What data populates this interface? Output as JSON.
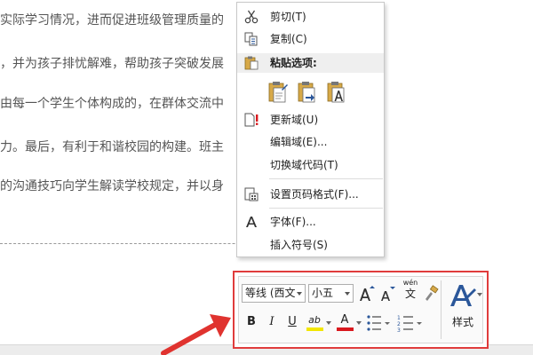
{
  "document": {
    "lines": [
      "实际学习情况，进而促进班级管理质量的",
      "，并为孩子排忧解难，帮助孩子突破发展",
      "由每一个学生个体构成的，在群体交流中",
      "力。最后，有利于和谐校园的构建。班主",
      "的沟通技巧向学生解读学校规定，并以身"
    ]
  },
  "context_menu": {
    "cut": "剪切(T)",
    "copy": "复制(C)",
    "paste_options": "粘贴选项:",
    "update_field": "更新域(U)",
    "edit_field": "编辑域(E)...",
    "toggle_field_codes": "切换域代码(T)",
    "page_number_format": "设置页码格式(F)...",
    "font": "字体(F)...",
    "insert_symbol": "插入符号(S)"
  },
  "mini_toolbar": {
    "font_name": "等线 (西文",
    "font_size": "小五",
    "phonetic_label": "wén",
    "phonetic_char": "文",
    "bold": "B",
    "italic": "I",
    "underline": "U",
    "highlight_label": "ab",
    "font_color_label": "A",
    "styles": "样式"
  },
  "colors": {
    "toolbar_highlight_border": "#e03c3c",
    "annotation_arrow": "#e0332f",
    "highlight_yellow": "#f2e600",
    "font_color_red": "#d9181e",
    "icon_blue": "#2b579a",
    "paste_gold": "#d7a948"
  }
}
